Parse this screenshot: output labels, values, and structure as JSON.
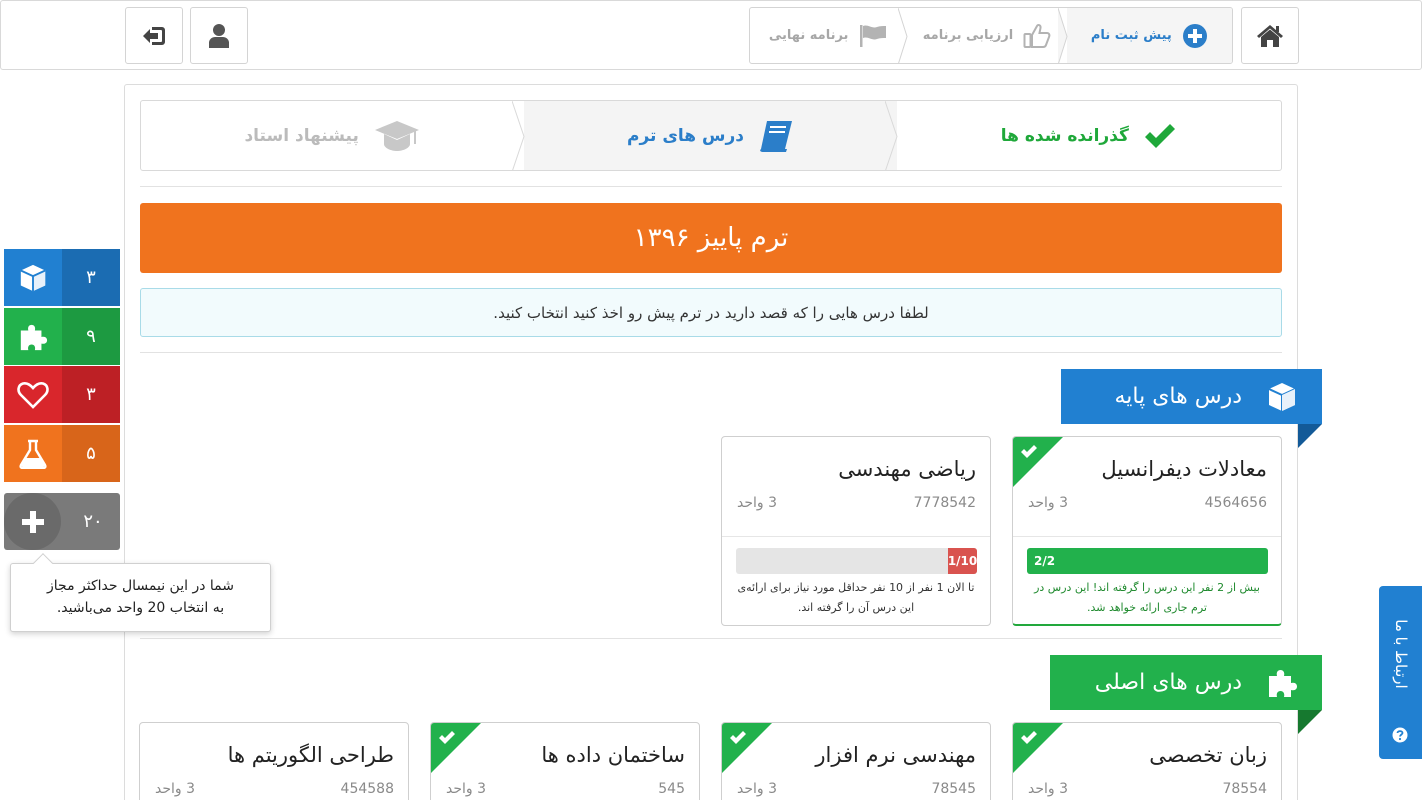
{
  "topbar": {
    "breadcrumb": [
      {
        "label": "برنامه نهایی",
        "icon": "flag-icon",
        "state": "inactive"
      },
      {
        "label": "ارزیابی برنامه",
        "icon": "thumbs-up-icon",
        "state": "inactive"
      },
      {
        "label": "پیش ثبت نام",
        "icon": "plus-circle-icon",
        "state": "active"
      }
    ],
    "buttons": [
      "logout-icon",
      "user-icon",
      "home-icon"
    ]
  },
  "steps": [
    {
      "label": "پیشنهاد استاد",
      "icon": "graduation-cap-icon",
      "state": "disabled"
    },
    {
      "label": "درس های ترم",
      "icon": "book-icon",
      "state": "current"
    },
    {
      "label": "گذرانده شده ها",
      "icon": "check-icon",
      "state": "done"
    }
  ],
  "term": {
    "title": "ترم پاییز ۱۳۹۶"
  },
  "info": {
    "message": "لطفا درس هایی را که قصد دارید در ترم پیش رو اخذ کنید انتخاب کنید."
  },
  "sections": [
    {
      "title": "درس های پایه",
      "icon": "cube-icon",
      "color": "#2180d1",
      "courses": [
        {
          "name": "معادلات دیفرانسیل",
          "code": "4564656",
          "units": "3 واحد",
          "selected": true,
          "capacity": "2/2",
          "fill": 1.0,
          "bar_color": "#22b14c",
          "note": "بیش از 2 نفر این درس را گرفته اند! این درس در ترم جاری ارائه خواهد شد.",
          "note_color": "#1f8a2e"
        },
        {
          "name": "ریاضی مهندسی",
          "code": "7778542",
          "units": "3 واحد",
          "selected": false,
          "capacity": "1/10",
          "fill": 0.1,
          "bar_color": "#d9534f",
          "note": "تا الان 1 نفر از 10 نفر حداقل مورد نیاز برای ارائه‌ی این درس آن را گرفته اند.",
          "note_color": "#333333"
        }
      ]
    },
    {
      "title": "درس های اصلی",
      "icon": "puzzle-icon",
      "color": "#22b14c",
      "courses": [
        {
          "name": "زبان تخصصی",
          "code": "78554",
          "units": "3 واحد",
          "selected": true
        },
        {
          "name": "مهندسی نرم افزار",
          "code": "78545",
          "units": "3 واحد",
          "selected": true
        },
        {
          "name": "ساختمان داده ها",
          "code": "545",
          "units": "3 واحد",
          "selected": true
        },
        {
          "name": "طراحی الگوریتم ها",
          "code": "454588",
          "units": "3 واحد",
          "selected": false
        }
      ]
    }
  ],
  "counters": [
    {
      "icon": "cube-icon",
      "count": "۳",
      "color": "#2180d1",
      "dark": "#1b6cb2"
    },
    {
      "icon": "puzzle-icon",
      "count": "۹",
      "color": "#22b14c",
      "dark": "#1d9a41"
    },
    {
      "icon": "heart-icon",
      "count": "۳",
      "color": "#d9262c",
      "dark": "#bd2025"
    },
    {
      "icon": "flask-icon",
      "count": "۵",
      "color": "#f0731e",
      "dark": "#d8651a"
    }
  ],
  "total": {
    "count": "۲۰",
    "icon": "plus-icon"
  },
  "tooltip": {
    "line1": "شما در این نیمسال حداکثر مجاز",
    "line2": "به انتخاب 20 واحد می‌باشید."
  },
  "contact": {
    "label": "ارتباط با ما",
    "icon": "question-icon"
  }
}
